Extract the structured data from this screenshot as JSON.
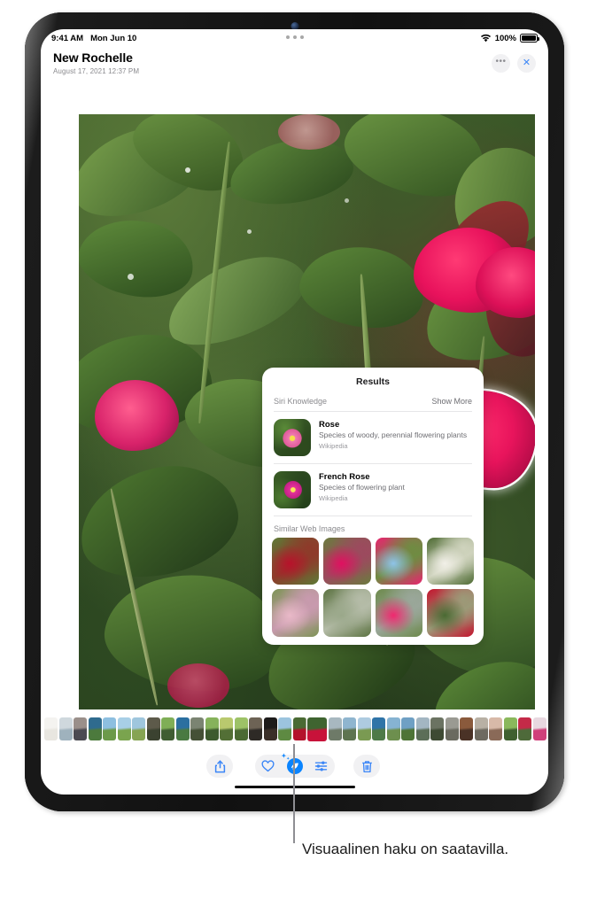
{
  "device": {
    "camera_icon": "front-camera-dot"
  },
  "status_bar": {
    "time": "9:41 AM",
    "date": "Mon Jun 10",
    "wifi_icon": "wifi-icon",
    "battery_percent": "100%",
    "battery_icon": "battery-full-icon",
    "multitask_handle_icon": "multitasking-handle-icon"
  },
  "header": {
    "title": "New Rochelle",
    "subtitle": "August 17, 2021  12:37 PM",
    "more_button": {
      "label": "•••",
      "icon": "ellipsis-icon"
    },
    "close_button": {
      "label": "✕",
      "icon": "close-icon"
    }
  },
  "popup": {
    "title": "Results",
    "siri_knowledge": {
      "label": "Siri Knowledge",
      "show_more": "Show More",
      "items": [
        {
          "name": "Rose",
          "description": "Species of woody, perennial flowering plants",
          "source": "Wikipedia",
          "thumb_icon": "pink-rose-thumbnail"
        },
        {
          "name": "French Rose",
          "description": "Species of flowering plant",
          "source": "Wikipedia",
          "thumb_icon": "magenta-rose-thumbnail"
        }
      ]
    },
    "similar_web_images": {
      "label": "Similar Web Images",
      "items": [
        {
          "name": "red-rose-bloom-thumbnail",
          "c1": "#b8122b",
          "c2": "#5d7a36",
          "c3": "#8e3a2a"
        },
        {
          "name": "magenta-rose-cluster-thumbnail",
          "c1": "#e01060",
          "c2": "#6a7b3e",
          "c3": "#9c4a5e"
        },
        {
          "name": "rose-bush-sky-thumbnail",
          "c1": "#8ec4e8",
          "c2": "#e8246e",
          "c3": "#6f8c42"
        },
        {
          "name": "white-rose-thumbnail",
          "c1": "#f2f0e8",
          "c2": "#4e6b33",
          "c3": "#cfd3bd"
        },
        {
          "name": "pale-pink-roses-thumbnail",
          "c1": "#e9b9c8",
          "c2": "#7d9455",
          "c3": "#c89aae"
        },
        {
          "name": "rose-garden-sign-thumbnail",
          "c1": "#9aa88a",
          "c2": "#5c7342",
          "c3": "#b5bca8"
        },
        {
          "name": "pink-rose-buds-thumbnail",
          "c1": "#f0286f",
          "c2": "#6d8a4c",
          "c3": "#9aa79a"
        },
        {
          "name": "climbing-rose-wall-thumbnail",
          "c1": "#4a6a33",
          "c2": "#c4142e",
          "c3": "#9c9a78"
        }
      ]
    }
  },
  "photo": {
    "subject_outline_icon": "visual-lookup-subject-highlight",
    "description_icon": "rose-bush-photo"
  },
  "filmstrip": {
    "selected_index": 18,
    "thumbnails": [
      {
        "name": "thumb-faded-1",
        "c1": "#f4f3f0",
        "c2": "#e8e6e0"
      },
      {
        "name": "thumb-faded-2",
        "c1": "#cfd8dd",
        "c2": "#9fb2bd"
      },
      {
        "name": "thumb-sunset-coast",
        "c1": "#9a8f8a",
        "c2": "#4b4a52"
      },
      {
        "name": "thumb-lake-green",
        "c1": "#2f6b8e",
        "c2": "#4c7a3d"
      },
      {
        "name": "thumb-field-sky",
        "c1": "#8dbfe0",
        "c2": "#6c9a4a"
      },
      {
        "name": "thumb-meadow",
        "c1": "#a8cfe6",
        "c2": "#7aa44e"
      },
      {
        "name": "thumb-garden-flowers",
        "c1": "#9fc6dd",
        "c2": "#86a453"
      },
      {
        "name": "thumb-stone-statue",
        "c1": "#5d5a4a",
        "c2": "#3b4230"
      },
      {
        "name": "thumb-green-hill",
        "c1": "#7fae56",
        "c2": "#3f5d32"
      },
      {
        "name": "thumb-lake-blue",
        "c1": "#2b6fa0",
        "c2": "#4a7a42"
      },
      {
        "name": "thumb-castle",
        "c1": "#7b8472",
        "c2": "#455036"
      },
      {
        "name": "thumb-forest-path",
        "c1": "#86b25b",
        "c2": "#3d5a2e"
      },
      {
        "name": "thumb-tree-field",
        "c1": "#b9c96e",
        "c2": "#536f36"
      },
      {
        "name": "thumb-pasture",
        "c1": "#9dc267",
        "c2": "#4b6a33"
      },
      {
        "name": "thumb-dusk-road",
        "c1": "#6d6355",
        "c2": "#2e2a26"
      },
      {
        "name": "thumb-night-portrait",
        "c1": "#1d1b1a",
        "c2": "#3a2f28"
      },
      {
        "name": "thumb-sky-tree",
        "c1": "#9cc4de",
        "c2": "#5e8a42"
      },
      {
        "name": "thumb-red-leaves",
        "c1": "#4a6a33",
        "c2": "#b4122c"
      },
      {
        "name": "thumb-rose-selected",
        "c1": "#3f6430",
        "c2": "#c8123a"
      },
      {
        "name": "thumb-lighthouse",
        "c1": "#a8b8c0",
        "c2": "#6e7a68"
      },
      {
        "name": "thumb-mountain",
        "c1": "#8fb5cf",
        "c2": "#5e7450"
      },
      {
        "name": "thumb-cloudy-field",
        "c1": "#aecbe0",
        "c2": "#7a9a52"
      },
      {
        "name": "thumb-blue-water",
        "c1": "#2f74a8",
        "c2": "#4e7a48"
      },
      {
        "name": "thumb-shore",
        "c1": "#86b3d2",
        "c2": "#6d8f4e"
      },
      {
        "name": "thumb-green-coast",
        "c1": "#6fa0c4",
        "c2": "#4e7436"
      },
      {
        "name": "thumb-cliff-sea",
        "c1": "#a3b6c2",
        "c2": "#5c6e58"
      },
      {
        "name": "thumb-ruins",
        "c1": "#6b7362",
        "c2": "#3e4a33"
      },
      {
        "name": "thumb-grey-stone",
        "c1": "#9a9a92",
        "c2": "#6a6a60"
      },
      {
        "name": "thumb-doorway",
        "c1": "#8a5a3c",
        "c2": "#4a3226"
      },
      {
        "name": "thumb-interior",
        "c1": "#b8b0a4",
        "c2": "#6e6a60"
      },
      {
        "name": "thumb-portrait-indoor",
        "c1": "#d8b9a8",
        "c2": "#8a6a58"
      },
      {
        "name": "thumb-green-lawn",
        "c1": "#8ab85c",
        "c2": "#3f6030"
      },
      {
        "name": "thumb-person-red",
        "c1": "#c42a48",
        "c2": "#4e6a3a"
      },
      {
        "name": "thumb-pink-bloom",
        "c1": "#e8d8e0",
        "c2": "#d0407a"
      },
      {
        "name": "thumb-faded-end",
        "c1": "#f2f1ee",
        "c2": "#e6e4df"
      }
    ]
  },
  "toolbar": {
    "share_button": {
      "label": "Share",
      "icon": "share-icon"
    },
    "favorite_button": {
      "label": "Favorite",
      "icon": "heart-icon"
    },
    "visual_lookup_button": {
      "label": "Visual Look Up",
      "icon": "visual-lookup-sparkle-icon",
      "active": true
    },
    "adjust_button": {
      "label": "Adjust",
      "icon": "sliders-icon"
    },
    "delete_button": {
      "label": "Delete",
      "icon": "trash-icon"
    },
    "home_indicator_icon": "home-indicator-bar"
  },
  "callout": {
    "text": "Visuaalinen haku on saatavilla.",
    "leader_icon": "callout-leader-line"
  },
  "colors": {
    "accent_blue": "#0a84ff",
    "icon_blue": "#3b86f7",
    "pill_gray": "#f1f1f3",
    "secondary_text": "#8a8a8e",
    "bezel": "#151515"
  }
}
